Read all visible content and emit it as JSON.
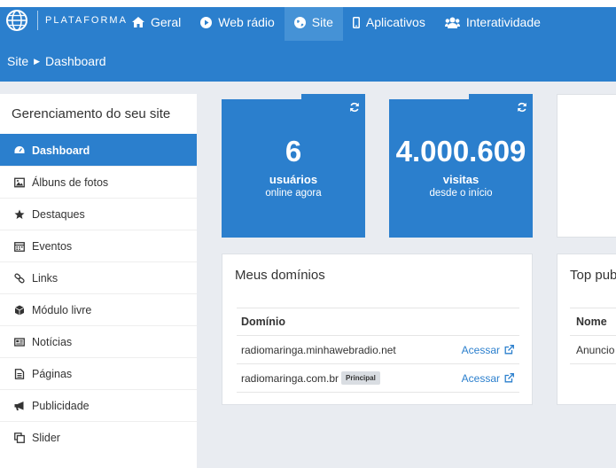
{
  "app": {
    "logo_text": "PLATAFORMA"
  },
  "nav": {
    "items": [
      {
        "label": "Geral",
        "icon": "home-icon"
      },
      {
        "label": "Web rádio",
        "icon": "play-circle-icon"
      },
      {
        "label": "Site",
        "icon": "globe-icon",
        "active": true
      },
      {
        "label": "Aplicativos",
        "icon": "mobile-icon"
      },
      {
        "label": "Interatividade",
        "icon": "users-icon"
      }
    ]
  },
  "breadcrumb": {
    "root": "Site",
    "current": "Dashboard"
  },
  "sidebar": {
    "title": "Gerenciamento do seu site",
    "items": [
      {
        "label": "Dashboard",
        "icon": "dashboard-icon",
        "active": true
      },
      {
        "label": "Álbuns de fotos",
        "icon": "picture-icon"
      },
      {
        "label": "Destaques",
        "icon": "star-icon"
      },
      {
        "label": "Eventos",
        "icon": "calendar-icon"
      },
      {
        "label": "Links",
        "icon": "link-icon"
      },
      {
        "label": "Módulo livre",
        "icon": "cube-icon"
      },
      {
        "label": "Notícias",
        "icon": "newspaper-icon"
      },
      {
        "label": "Páginas",
        "icon": "file-icon"
      },
      {
        "label": "Publicidade",
        "icon": "bullhorn-icon"
      },
      {
        "label": "Slider",
        "icon": "clone-icon"
      }
    ]
  },
  "stats": {
    "users": {
      "value": "6",
      "label": "usuários",
      "sub": "online agora"
    },
    "visits": {
      "value": "4.000.609",
      "label": "visitas",
      "sub": "desde o início"
    }
  },
  "domains": {
    "title": "Meus domínios",
    "column": "Domínio",
    "rows": [
      {
        "domain": "radiomaringa.minhawebradio.net",
        "action": "Acessar"
      },
      {
        "domain": "radiomaringa.com.br",
        "badge": "Principal",
        "action": "Acessar"
      }
    ]
  },
  "top_pub": {
    "title": "Top pub",
    "column": "Nome",
    "row": "Anuncio"
  },
  "colors": {
    "primary": "#2b7fcd",
    "nav_active": "#4592d6",
    "background": "#e9ecf1"
  }
}
